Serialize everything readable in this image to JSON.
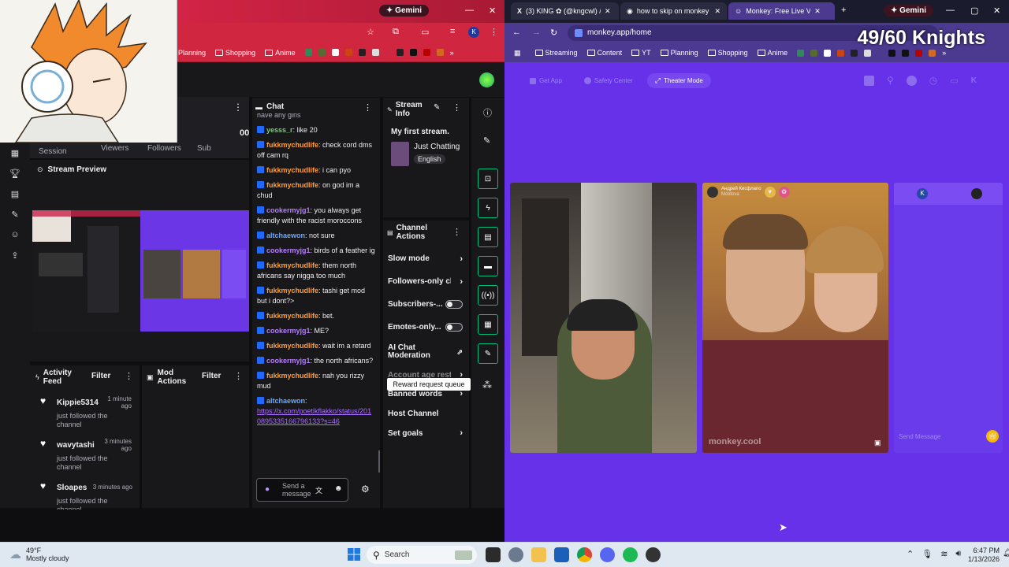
{
  "left_window": {
    "tabs": {
      "gemini_label": "Gemini"
    },
    "bookmarks": [
      "Planning",
      "Shopping",
      "Anime"
    ],
    "overlay_text": "49/60 Knights",
    "stats": {
      "headers": [
        "Session",
        "Viewers",
        "Followers",
        "Sub"
      ],
      "values": [
        "-",
        "00"
      ]
    },
    "stream_preview": {
      "title": "Stream Preview"
    },
    "activity_feed": {
      "title": "Activity Feed",
      "filter": "Filter",
      "items": [
        {
          "name": "Kippie5314",
          "time": "1 minute ago",
          "action": "just followed the channel"
        },
        {
          "name": "wavytashi",
          "time": "3 minutes ago",
          "action": "just followed the channel"
        },
        {
          "name": "Sloapes",
          "time": "3 minutes ago",
          "action": "just followed the channel"
        }
      ]
    },
    "mod_actions": {
      "title": "Mod Actions",
      "filter": "Filter"
    },
    "chat": {
      "title": "Chat",
      "top_cut": "have any girls",
      "messages": [
        {
          "user": "yesss_r",
          "cls": "u-gr",
          "text": "like 20"
        },
        {
          "user": "fukkmychudlife",
          "cls": "u-or",
          "text": "check cord dms off cam rq"
        },
        {
          "user": "fukkmychudlife",
          "cls": "u-or",
          "text": "i can pyo"
        },
        {
          "user": "fukkmychudlife",
          "cls": "u-or",
          "text": "on god im a chud"
        },
        {
          "user": "cookermyjg1",
          "cls": "u-pu",
          "text": "you always get friendly with the racist moroccons"
        },
        {
          "user": "altchaewon",
          "cls": "u-bl",
          "text": "not sure"
        },
        {
          "user": "cookermyjg1",
          "cls": "u-pu",
          "text": "birds of a feather ig"
        },
        {
          "user": "fukkmychudlife",
          "cls": "u-or",
          "text": "them north africans say nigga too much"
        },
        {
          "user": "fukkmychudlife",
          "cls": "u-or",
          "text": "tashi get mod but i dont?>"
        },
        {
          "user": "fukkmychudlife",
          "cls": "u-or",
          "text": "bet."
        },
        {
          "user": "cookermyjg1",
          "cls": "u-pu",
          "text": "ME?"
        },
        {
          "user": "fukkmychudlife",
          "cls": "u-or",
          "text": "wait im a retard"
        },
        {
          "user": "cookermyjg1",
          "cls": "u-pu",
          "text": "the north africans?"
        },
        {
          "user": "fukkmychudlife",
          "cls": "u-or",
          "text": "nah you rizzy mud"
        }
      ],
      "last_user": "altchaewon",
      "last_link": "https://x.com/poetikflakko/status/2010895335166796133?s=46",
      "input_placeholder": "Send a message"
    },
    "stream_info": {
      "title": "Stream Info",
      "stream_title": "My first stream.",
      "category": "Just Chatting",
      "language": "English"
    },
    "channel_actions": {
      "title": "Channel Actions",
      "items": [
        "Slow mode",
        "Followers-only ch",
        "Subscribers-...",
        "Emotes-only...",
        "AI Chat Moderation",
        "Account age restr",
        "Banned words",
        "Host Channel",
        "Set goals"
      ],
      "tooltip": "Reward request queue"
    }
  },
  "right_window": {
    "tabs": [
      {
        "label": "(3) KING ✿ (@kngcwl) / X"
      },
      {
        "label": "how to skip on monkey"
      },
      {
        "label": "Monkey: Free Live Vi"
      }
    ],
    "gemini_label": "Gemini",
    "url": "monkey.app/home",
    "bookmarks": [
      "Streaming",
      "Content",
      "YT",
      "Planning",
      "Shopping",
      "Anime"
    ],
    "knights_overlay": "49/60 Knights",
    "nav": {
      "get_app": "Get App",
      "safety_center": "Safety Center",
      "theater_mode": "Theater Mode",
      "avatar": "K"
    },
    "video2": {
      "name": "Андрей Кисфлапо",
      "location": "Moldova",
      "watermark": "monkey.cool"
    },
    "video3": {
      "avatar": "K",
      "send_placeholder": "Send Message"
    }
  },
  "taskbar": {
    "weather_temp": "49°F",
    "weather_desc": "Mostly cloudy",
    "search": "Search",
    "time": "6:47 PM",
    "date": "1/13/2026"
  }
}
